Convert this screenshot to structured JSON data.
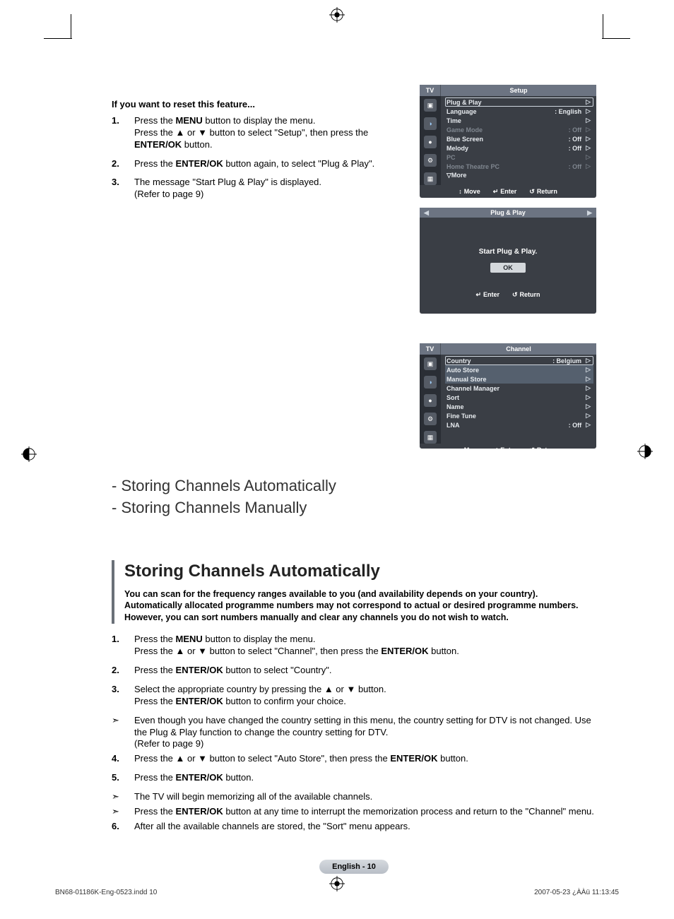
{
  "reset": {
    "heading": "If you want to reset this feature...",
    "steps": [
      "Press the MENU button to display the menu.\nPress the ▲ or ▼ button to select \"Setup\", then press the ENTER/OK button.",
      "Press the ENTER/OK button again, to select \"Plug & Play\".",
      "The message \"Start Plug & Play\" is displayed.\n(Refer to page 9)"
    ]
  },
  "osd_setup": {
    "tv_tab": "TV",
    "title": "Setup",
    "rows": [
      {
        "label": "Plug & Play",
        "value": "",
        "selected": true,
        "dim": false
      },
      {
        "label": "Language",
        "value": ": English",
        "selected": false,
        "dim": false
      },
      {
        "label": "Time",
        "value": "",
        "selected": false,
        "dim": false
      },
      {
        "label": "Game Mode",
        "value": ": Off",
        "selected": false,
        "dim": true
      },
      {
        "label": "Blue Screen",
        "value": ": Off",
        "selected": false,
        "dim": false
      },
      {
        "label": "Melody",
        "value": ": Off",
        "selected": false,
        "dim": false
      },
      {
        "label": "PC",
        "value": "",
        "selected": false,
        "dim": true
      },
      {
        "label": "Home Theatre PC",
        "value": ": Off",
        "selected": false,
        "dim": true
      },
      {
        "label": "▽More",
        "value": "",
        "selected": false,
        "dim": false
      }
    ],
    "footer": {
      "move": "Move",
      "enter": "Enter",
      "ret": "Return"
    }
  },
  "osd_pnp": {
    "title": "Plug & Play",
    "msg": "Start Plug & Play.",
    "ok": "OK",
    "footer": {
      "enter": "Enter",
      "ret": "Return"
    }
  },
  "osd_channel": {
    "tv_tab": "TV",
    "title": "Channel",
    "rows": [
      {
        "label": "Country",
        "value": ": Belgium",
        "selected": true,
        "dim": false
      },
      {
        "label": "Auto Store",
        "value": "",
        "selected": false,
        "dim": false,
        "inner": true
      },
      {
        "label": "Manual Store",
        "value": "",
        "selected": false,
        "dim": false,
        "inner": true
      },
      {
        "label": "Channel Manager",
        "value": "",
        "selected": false,
        "dim": false
      },
      {
        "label": "Sort",
        "value": "",
        "selected": false,
        "dim": false
      },
      {
        "label": "Name",
        "value": "",
        "selected": false,
        "dim": false
      },
      {
        "label": "Fine Tune",
        "value": "",
        "selected": false,
        "dim": false
      },
      {
        "label": "LNA",
        "value": ": Off",
        "selected": false,
        "dim": false
      }
    ],
    "footer": {
      "move": "Move",
      "enter": "Enter",
      "ret": "Return"
    }
  },
  "toc": {
    "items": [
      "- Storing Channels Automatically",
      "- Storing Channels Manually"
    ]
  },
  "section": {
    "title": "Storing Channels Automatically",
    "intro": "You can scan for the frequency ranges available to you (and availability depends on your country). Automatically allocated programme numbers may not correspond to actual or desired programme numbers. However, you can sort numbers manually and clear any channels you do not wish to watch."
  },
  "steps": [
    {
      "type": "num",
      "n": "1.",
      "text": "Press the MENU button to display the menu.\nPress the ▲ or ▼ button to select \"Channel\", then press the ENTER/OK button."
    },
    {
      "type": "num",
      "n": "2.",
      "text": "Press the ENTER/OK button to select \"Country\"."
    },
    {
      "type": "num",
      "n": "3.",
      "text": "Select the appropriate country by pressing the ▲ or ▼ button.\nPress the ENTER/OK button to confirm your choice."
    },
    {
      "type": "note",
      "text": "Even though you have changed the country setting in this menu, the country setting for DTV is not changed. Use the Plug & Play function to change the country setting for DTV.\n(Refer to page 9)"
    },
    {
      "type": "num",
      "n": "4.",
      "text": "Press the ▲ or ▼ button to select \"Auto Store\", then press the ENTER/OK button."
    },
    {
      "type": "num",
      "n": "5.",
      "text": "Press the ENTER/OK button."
    },
    {
      "type": "note",
      "text": "The TV will begin memorizing all of the available channels."
    },
    {
      "type": "note",
      "text": "Press the ENTER/OK button at any time to interrupt the memorization process and return to the \"Channel\" menu."
    },
    {
      "type": "num",
      "n": "6.",
      "text": "After all the available channels are stored, the \"Sort\" menu appears."
    }
  ],
  "page_footer": "English - 10",
  "meta": {
    "file": "BN68-01186K-Eng-0523.indd   10",
    "date": "2007-05-23   ¿ÀÀü 11:13:45"
  }
}
